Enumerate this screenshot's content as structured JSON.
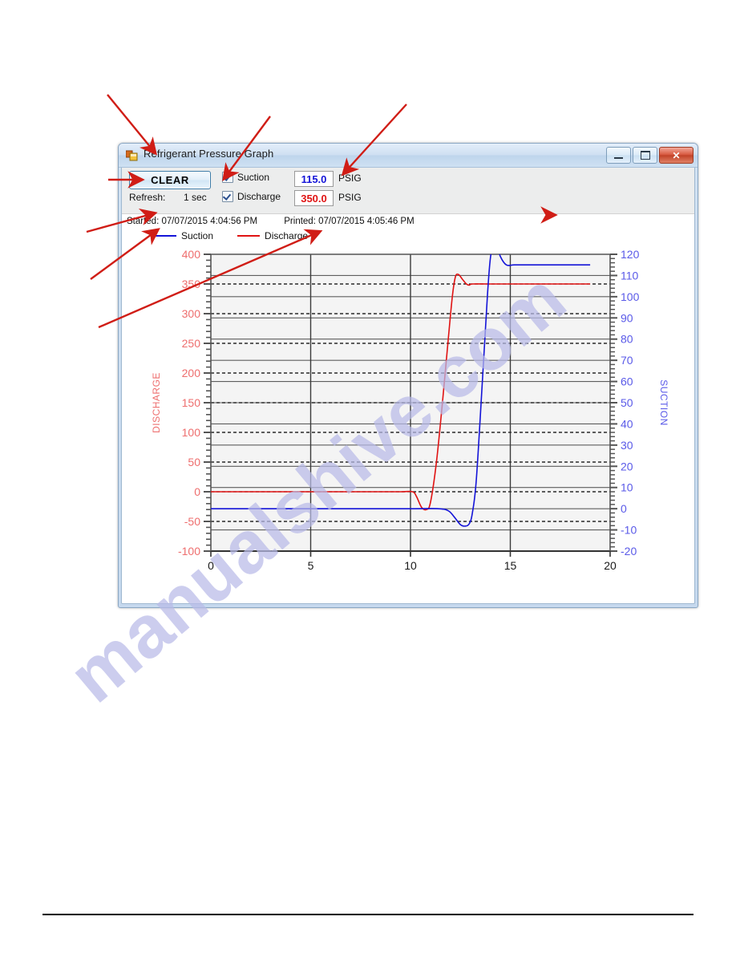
{
  "window": {
    "title": "Refrigerant Pressure Graph",
    "icon": "vb-form-icon",
    "controls": {
      "minimize": "minimize-icon",
      "maximize": "maximize-icon",
      "close": "✕"
    }
  },
  "toolbar": {
    "clear_label": "CLEAR",
    "refresh_label": "Refresh:",
    "refresh_value": "1 sec",
    "suction": {
      "checkbox_checked": true,
      "label": "Suction",
      "value": "115.0",
      "unit": "PSIG",
      "color": "#1414d8"
    },
    "discharge": {
      "checkbox_checked": true,
      "label": "Discharge",
      "value": "350.0",
      "unit": "PSIG",
      "color": "#e01313"
    }
  },
  "info": {
    "started_label": "Started:",
    "started_value": "07/07/2015 4:04:56 PM",
    "printed_label": "Printed:",
    "printed_value": "07/07/2015 4:05:46 PM"
  },
  "legend": {
    "suction_label": "Suction",
    "discharge_label": "Discharge"
  },
  "watermark": {
    "text": "manualshive.com"
  },
  "chart_data": {
    "type": "line",
    "title": "",
    "xlabel": "",
    "xlim": [
      0,
      20
    ],
    "xticks": [
      0,
      5,
      10,
      15,
      20
    ],
    "grid": true,
    "legend_position": "top-left",
    "axes": [
      {
        "id": "left",
        "label": "DISCHARGE",
        "color": "#ee6e6e",
        "lim": [
          -100,
          400
        ],
        "ticks": [
          -100,
          -50,
          0,
          50,
          100,
          150,
          200,
          250,
          300,
          350,
          400
        ],
        "minor_step": 10,
        "gridline_style": "dashed-black"
      },
      {
        "id": "right",
        "label": "SUCTION",
        "color": "#5a5ae8",
        "lim": [
          -20,
          120
        ],
        "ticks": [
          -20,
          -10,
          0,
          10,
          20,
          30,
          40,
          50,
          60,
          70,
          80,
          90,
          100,
          110,
          120
        ],
        "minor_step": 2,
        "gridline_style": "solid-gray"
      }
    ],
    "series": [
      {
        "name": "Discharge",
        "axis": "left",
        "color": "#e01313",
        "unit": "PSIG",
        "x": [
          0,
          2,
          4,
          6,
          8,
          9.5,
          10.1,
          10.3,
          10.55,
          10.8,
          11.0,
          11.3,
          11.6,
          11.9,
          12.1,
          12.25,
          12.4,
          12.6,
          12.8,
          12.95,
          13.1,
          14,
          16,
          18,
          19
        ],
        "y": [
          0,
          0,
          0,
          0,
          0,
          0,
          0,
          -8,
          -26,
          -30,
          -18,
          50,
          150,
          260,
          330,
          362,
          366,
          358,
          350,
          348,
          350,
          350,
          350,
          350,
          350
        ]
      },
      {
        "name": "Suction",
        "axis": "right",
        "color": "#1414d8",
        "unit": "PSIG",
        "x": [
          0,
          2,
          4,
          6,
          8,
          10,
          11.4,
          11.9,
          12.2,
          12.5,
          12.75,
          12.95,
          13.1,
          13.3,
          13.6,
          13.85,
          14.0,
          14.15,
          14.35,
          14.5,
          14.8,
          15.2,
          16,
          17,
          18,
          19
        ],
        "y": [
          0,
          0,
          0,
          0,
          0,
          0,
          0,
          -1,
          -4,
          -7.5,
          -8.2,
          -7,
          -2,
          14,
          60,
          100,
          118,
          124,
          124,
          119,
          115,
          115,
          115,
          115,
          115,
          115
        ]
      }
    ]
  },
  "annotations": {
    "arrow_color": "#d01d16",
    "count": 8
  }
}
